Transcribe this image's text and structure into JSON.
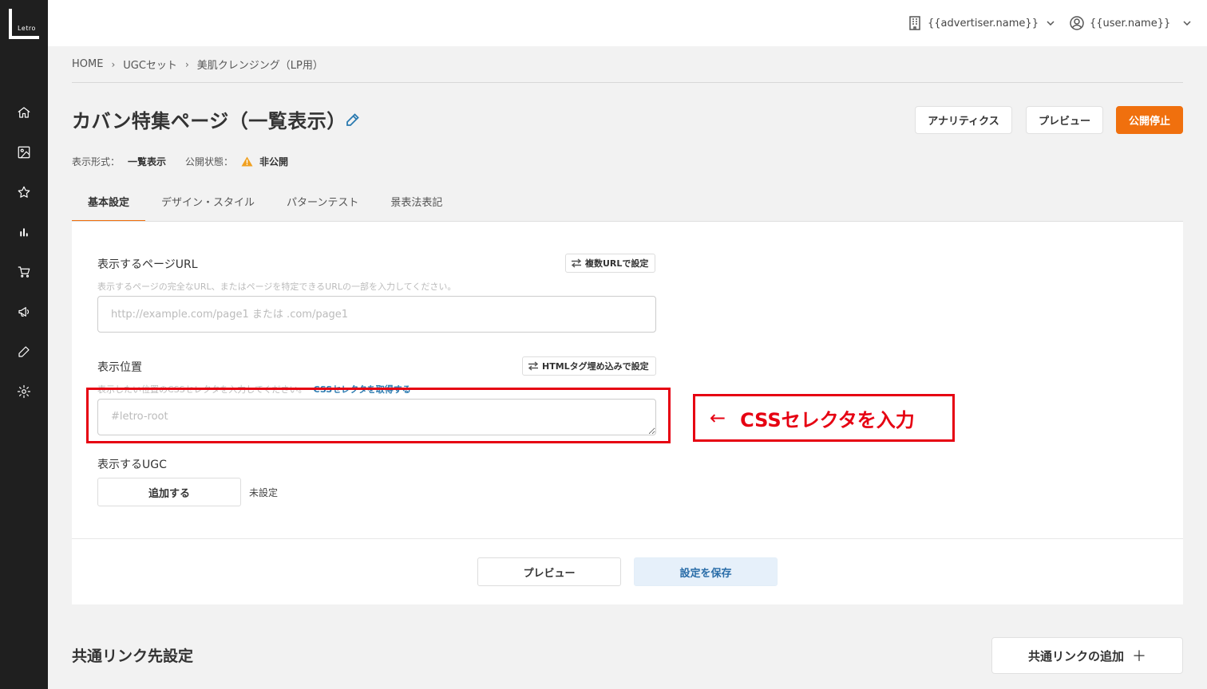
{
  "logo": {
    "text": "Letro"
  },
  "sidebar": {
    "items": [
      {
        "icon": "home-icon"
      },
      {
        "icon": "image-icon"
      },
      {
        "icon": "star-icon"
      },
      {
        "icon": "chart-icon"
      },
      {
        "icon": "cart-icon"
      },
      {
        "icon": "megaphone-icon"
      },
      {
        "icon": "pen-icon"
      },
      {
        "icon": "gear-icon"
      }
    ]
  },
  "header": {
    "advertiser": "{{advertiser.name}}",
    "user": "{{user.name}}"
  },
  "breadcrumb": {
    "items": [
      "HOME",
      "UGCセット",
      "美肌クレンジング（LP用）"
    ],
    "separator": "›"
  },
  "page": {
    "title": "カバン特集ページ（一覧表示）",
    "buttons": {
      "analytics": "アナリティクス",
      "preview": "プレビュー",
      "unpublish": "公開停止"
    },
    "meta": {
      "format_label": "表示形式：",
      "format_value": "一覧表示",
      "status_label": "公開状態：",
      "status_value": "非公開"
    }
  },
  "tabs": [
    {
      "label": "基本設定",
      "active": true
    },
    {
      "label": "デザイン・スタイル",
      "active": false
    },
    {
      "label": "パターンテスト",
      "active": false
    },
    {
      "label": "景表法表記",
      "active": false
    }
  ],
  "form": {
    "url": {
      "label": "表示するページURL",
      "button": "複数URLで設定",
      "hint": "表示するページの完全なURL、またはページを特定できるURLの一部を入力してください。",
      "placeholder": "http://example.com/page1 または .com/page1"
    },
    "position": {
      "label": "表示位置",
      "button": "HTMLタグ埋め込みで設定",
      "hint": "表示したい位置のCSSセレクタを入力してください。",
      "hint_link": "CSSセレクタを取得する",
      "placeholder": "#letro-root"
    },
    "ugc": {
      "label": "表示するUGC",
      "button": "追加する",
      "status": "未設定"
    }
  },
  "footer": {
    "preview": "プレビュー",
    "save": "設定を保存"
  },
  "annotation": {
    "arrow": "←",
    "text": "CSSセレクタを入力"
  },
  "common_link": {
    "title": "共通リンク先設定",
    "button": "共通リンクの追加",
    "plus": "＋"
  },
  "colors": {
    "accent": "#f0700e",
    "link": "#2a7ab0",
    "annotation": "#e60012",
    "sidebar": "#1f1f1f"
  }
}
